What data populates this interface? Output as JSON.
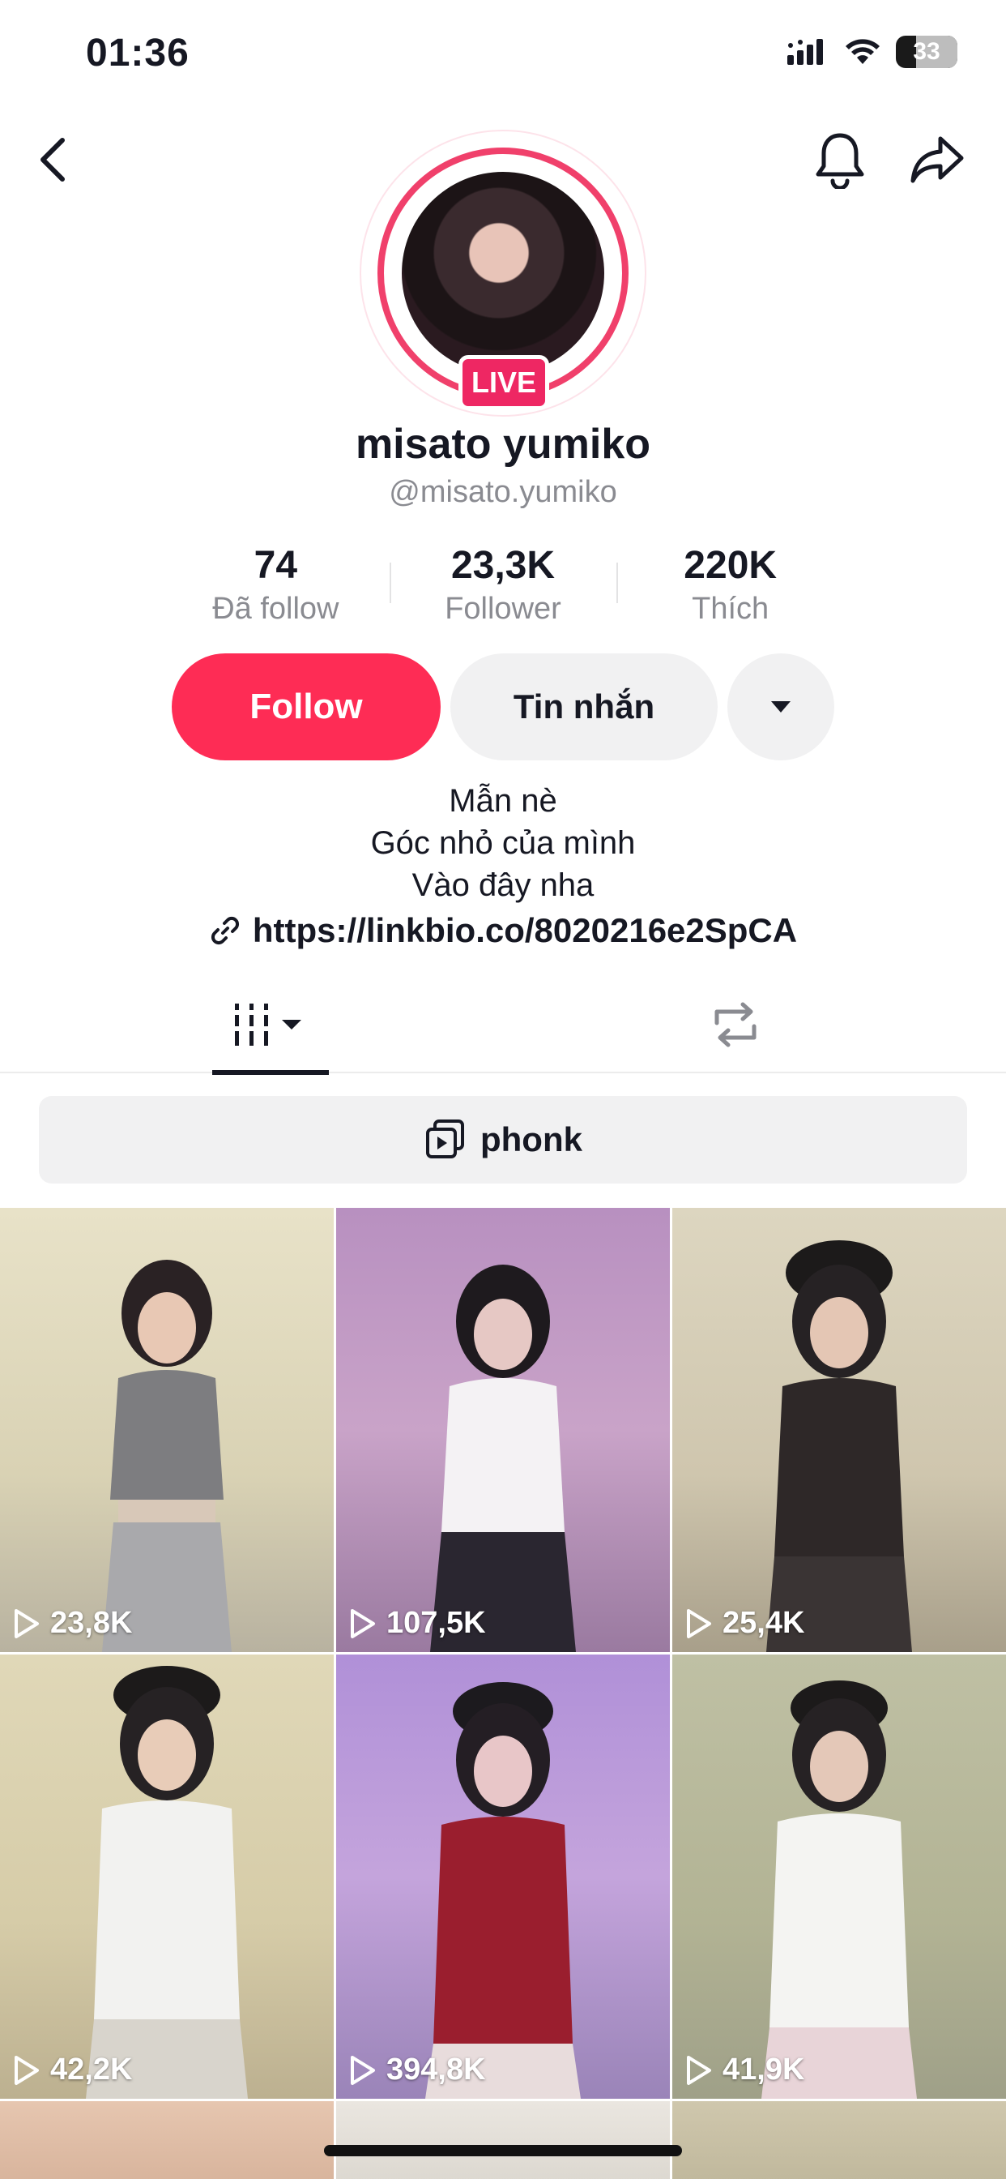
{
  "status_bar": {
    "time": "01:36",
    "battery": "33",
    "battery_level": 0.33
  },
  "profile": {
    "display_name": "misato yumiko",
    "username": "@misato.yumiko",
    "live_label": "LIVE"
  },
  "stats": [
    {
      "value": "74",
      "label": "Đã follow"
    },
    {
      "value": "23,3K",
      "label": "Follower"
    },
    {
      "value": "220K",
      "label": "Thích"
    }
  ],
  "actions": {
    "follow": "Follow",
    "message": "Tin nhắn"
  },
  "bio": {
    "lines": [
      "Mẫn nè",
      "Góc nhỏ của mình",
      "Vào đây nha"
    ],
    "link": "https://linkbio.co/8020216e2SpCA"
  },
  "playlist": {
    "label": "phonk"
  },
  "videos": [
    {
      "views": "23,8K"
    },
    {
      "views": "107,5K"
    },
    {
      "views": "25,4K"
    },
    {
      "views": "42,2K"
    },
    {
      "views": "394,8K"
    },
    {
      "views": "41,9K"
    }
  ],
  "colors": {
    "accent": "#fe2c55",
    "live": "#ee2763",
    "ring": "#f0406b"
  }
}
